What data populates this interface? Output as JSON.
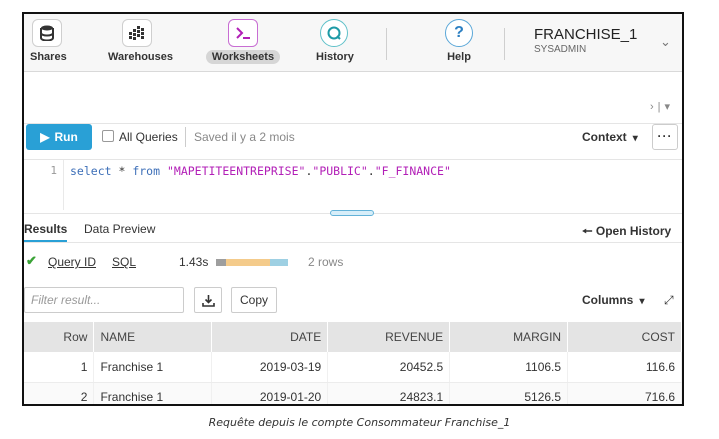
{
  "nav": {
    "items": [
      {
        "label": "Shares",
        "icon": "database-icon"
      },
      {
        "label": "Warehouses",
        "icon": "grid-icon"
      },
      {
        "label": "Worksheets",
        "icon": "terminal-icon",
        "active": true
      },
      {
        "label": "History",
        "icon": "history-icon"
      },
      {
        "label": "Help",
        "icon": "help-icon"
      }
    ],
    "account": {
      "name": "FRANCHISE_1",
      "role": "SYSADMIN"
    }
  },
  "toolbar": {
    "run_label": "Run",
    "all_queries_label": "All Queries",
    "saved_label": "Saved il y a 2 mois",
    "context_label": "Context",
    "more_label": "···"
  },
  "editor": {
    "line_number": "1",
    "tokens": {
      "select": "select",
      "star": " * ",
      "from": "from",
      "s1": "\"MAPETITEENTREPRISE\"",
      "d1": ".",
      "s2": "\"PUBLIC\"",
      "d2": ".",
      "s3": "\"F_FINANCE\""
    }
  },
  "results": {
    "tabs": [
      "Results",
      "Data Preview"
    ],
    "open_history": "Open History",
    "query_id": "Query ID",
    "sql": "SQL",
    "time": "1.43s",
    "rows": "2 rows",
    "filter_placeholder": "Filter result...",
    "copy_label": "Copy",
    "columns_label": "Columns",
    "headers": [
      "Row",
      "NAME",
      "DATE",
      "REVENUE",
      "MARGIN",
      "COST"
    ],
    "rows_data": [
      [
        "1",
        "Franchise 1",
        "2019-03-19",
        "20452.5",
        "1106.5",
        "116.6"
      ],
      [
        "2",
        "Franchise 1",
        "2019-01-20",
        "24823.1",
        "5126.5",
        "716.6"
      ]
    ]
  },
  "caption": "Requête depuis le compte Consommateur Franchise_1",
  "colors": {
    "accent": "#29a0d6",
    "success": "#3aa336",
    "keyword": "#3d6fb8",
    "string": "#b21fb7"
  }
}
